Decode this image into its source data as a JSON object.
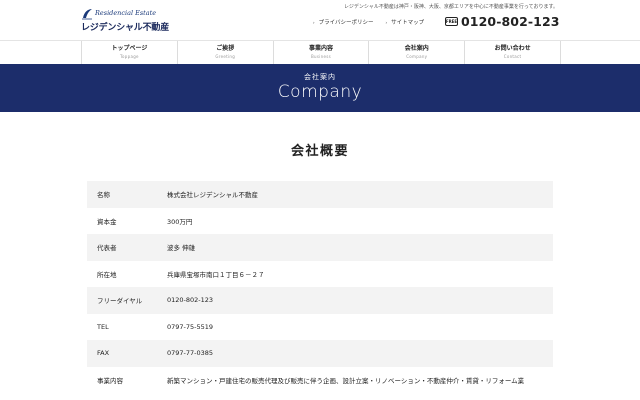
{
  "header": {
    "tagline": "レジデンシャル不動産は神戸・阪神、大阪、京都エリアを中心に不動産事業を行っております。",
    "logo_en": "Residencial Estate",
    "logo_jp": "レジデンシャル不動産",
    "links": [
      {
        "label": "プライバシーポリシー"
      },
      {
        "label": "サイトマップ"
      }
    ],
    "phone_badge": "FREE",
    "phone": "0120-802-123"
  },
  "nav": [
    {
      "jp": "トップページ",
      "en": "Toppage"
    },
    {
      "jp": "ご挨拶",
      "en": "Greeting"
    },
    {
      "jp": "事業内容",
      "en": "Business"
    },
    {
      "jp": "会社案内",
      "en": "Company"
    },
    {
      "jp": "お問い合わせ",
      "en": "Contact"
    }
  ],
  "banner": {
    "jp": "会社案内",
    "en": "Company"
  },
  "section_title": "会社概要",
  "company_table": [
    {
      "label": "名称",
      "value": "株式会社レジデンシャル不動産"
    },
    {
      "label": "資本金",
      "value": "300万円"
    },
    {
      "label": "代表者",
      "value": "波多 伸雄"
    },
    {
      "label": "所在地",
      "value": "兵庫県宝塚市南口１丁目６－２７"
    },
    {
      "label": "フリーダイヤル",
      "value": "0120-802-123"
    },
    {
      "label": "TEL",
      "value": "0797-75-5519"
    },
    {
      "label": "FAX",
      "value": "0797-77-0385"
    },
    {
      "label": "事業内容",
      "value": "新築マンション・戸建住宅の販売代理及び販売に伴う企画、設計立案・リノベーション・不動産仲介・賃貸・リフォーム業"
    }
  ],
  "colors": {
    "brand_navy": "#1c2d6b",
    "row_gray": "#f3f3f3"
  }
}
